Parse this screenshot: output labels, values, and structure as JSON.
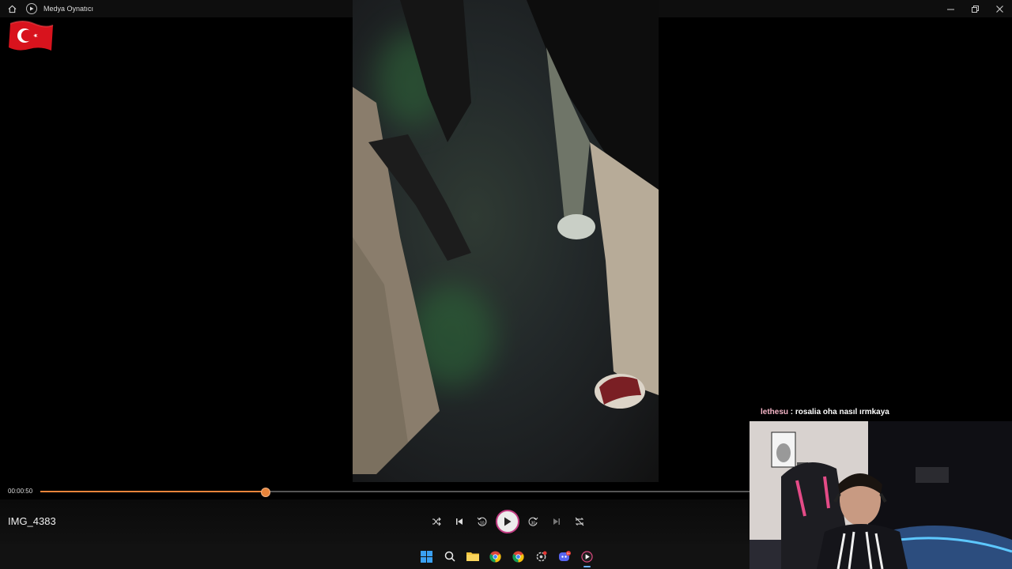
{
  "titlebar": {
    "app_name": "Medya Oynatıcı",
    "icons": [
      "home-icon",
      "media-player-icon",
      "minimize-icon",
      "restore-icon",
      "close-icon"
    ]
  },
  "player": {
    "current_time": "00:00:50",
    "progress_fraction": 0.317,
    "media_title": "IMG_4383",
    "accent_color": "#e8843a",
    "controls": [
      "shuffle-icon",
      "previous-icon",
      "rewind-10-icon",
      "play-icon",
      "forward-30-icon",
      "next-icon",
      "repeat-off-icon"
    ]
  },
  "taskbar": {
    "icons": [
      "windows-start-icon",
      "search-icon",
      "file-explorer-icon",
      "chrome-icon",
      "chrome-icon",
      "settings-icon",
      "discord-icon",
      "media-player-icon"
    ],
    "discord_badge": "9+"
  },
  "chat": {
    "username": "lethesu",
    "separator": " : ",
    "message": "rosalia oha nasıl ırmkaya"
  }
}
